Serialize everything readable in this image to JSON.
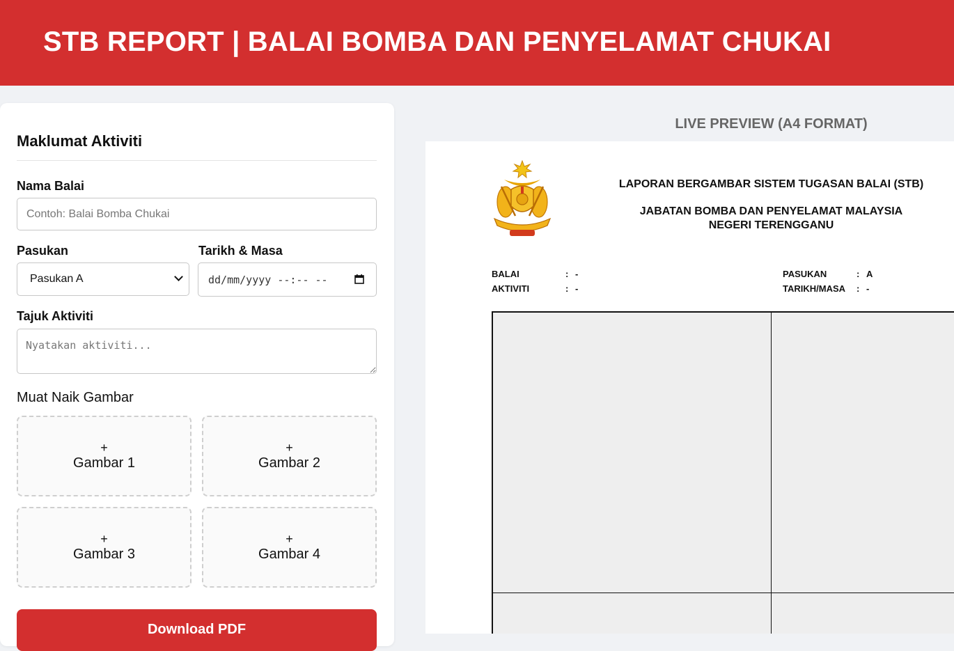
{
  "header": {
    "title": "STB REPORT | BALAI BOMBA DAN PENYELAMAT CHUKAI"
  },
  "form": {
    "section_title": "Maklumat Aktiviti",
    "nama_balai": {
      "label": "Nama Balai",
      "placeholder": "Contoh: Balai Bomba Chukai",
      "value": ""
    },
    "pasukan": {
      "label": "Pasukan",
      "selected": "Pasukan A"
    },
    "tarikh": {
      "label": "Tarikh & Masa",
      "placeholder": "dd/mm/yyyy --:-- --"
    },
    "tajuk": {
      "label": "Tajuk Aktiviti",
      "placeholder": "Nyatakan aktiviti..."
    },
    "upload": {
      "label": "Muat Naik Gambar",
      "plus": "+",
      "slots": [
        "Gambar 1",
        "Gambar 2",
        "Gambar 3",
        "Gambar 4"
      ]
    },
    "download_label": "Download PDF"
  },
  "preview": {
    "title": "LIVE PREVIEW (A4 FORMAT)",
    "report_title": "LAPORAN BERGAMBAR SISTEM TUGASAN BALAI (STB)",
    "agency_line1": "JABATAN BOMBA DAN PENYELAMAT MALAYSIA",
    "agency_line2": "NEGERI TERENGGANU",
    "logo": {
      "icon": "bomba-crest-icon",
      "ribbon_text": "BOMBA DAN PENYELAMAT",
      "bottom_text": "MALAYSIA"
    },
    "fields": {
      "balai": {
        "label": "BALAI",
        "sep": ":",
        "value": "-"
      },
      "aktiviti": {
        "label": "AKTIVITI",
        "sep": ":",
        "value": "-"
      },
      "pasukan": {
        "label": "PASUKAN",
        "sep": ":",
        "value": "A"
      },
      "tarikh": {
        "label": "TARIKH/MASA",
        "sep": ":",
        "value": "-"
      }
    }
  },
  "colors": {
    "brand_red": "#d32f2f",
    "page_bg": "#f0f2f5",
    "photo_bg": "#eeeeee"
  }
}
